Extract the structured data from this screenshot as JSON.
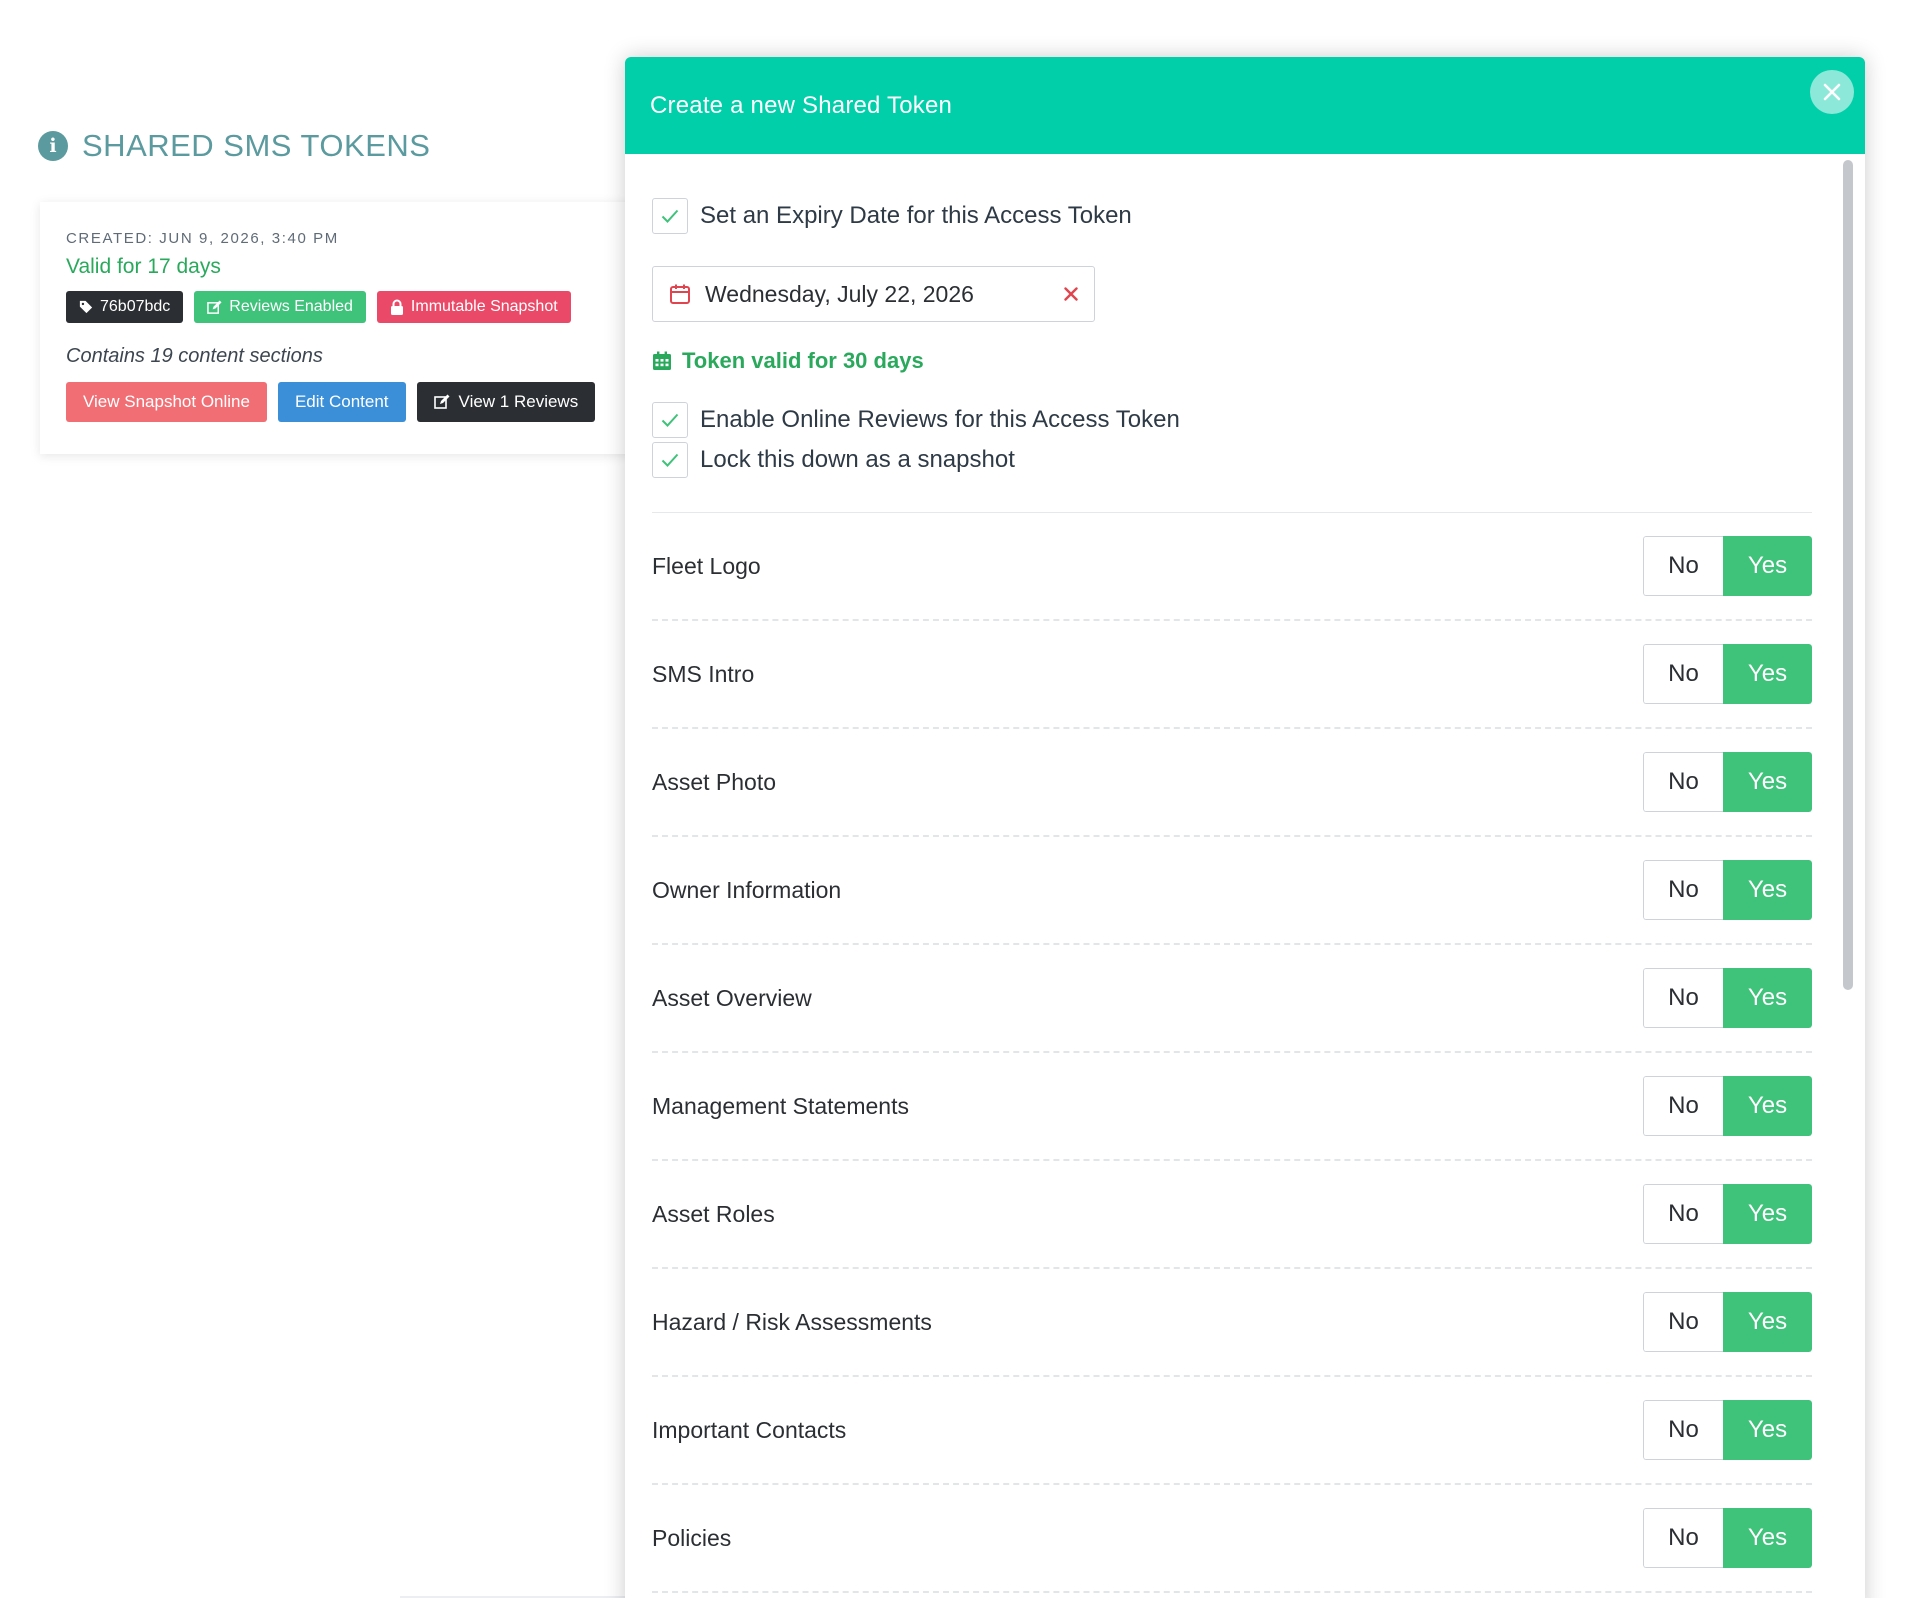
{
  "page": {
    "title": "SHARED SMS TOKENS"
  },
  "token_card": {
    "created": "CREATED: JUN 9, 2026, 3:40 PM",
    "valid": "Valid for 17 days",
    "badges": {
      "id": "76b07bdc",
      "reviews": "Reviews Enabled",
      "snapshot": "Immutable Snapshot"
    },
    "sections_text": "Contains 19 content sections",
    "actions": {
      "view_snapshot": "View Snapshot Online",
      "edit_content": "Edit Content",
      "view_reviews": "View 1 Reviews"
    }
  },
  "modal": {
    "title": "Create a new Shared Token",
    "expiry_checkbox": "Set an Expiry Date for this Access Token",
    "expiry_date": "Wednesday, July 22, 2026",
    "valid_note": "Token valid for 30 days",
    "reviews_checkbox": "Enable Online Reviews for this Access Token",
    "snapshot_checkbox": "Lock this down as a snapshot",
    "toggle_no": "No",
    "toggle_yes": "Yes",
    "sections": [
      {
        "label": "Fleet Logo",
        "value": "Yes"
      },
      {
        "label": "SMS Intro",
        "value": "Yes"
      },
      {
        "label": "Asset Photo",
        "value": "Yes"
      },
      {
        "label": "Owner Information",
        "value": "Yes"
      },
      {
        "label": "Asset Overview",
        "value": "Yes"
      },
      {
        "label": "Management Statements",
        "value": "Yes"
      },
      {
        "label": "Asset Roles",
        "value": "Yes"
      },
      {
        "label": "Hazard / Risk Assessments",
        "value": "Yes"
      },
      {
        "label": "Important Contacts",
        "value": "Yes"
      },
      {
        "label": "Policies",
        "value": "Yes"
      }
    ]
  },
  "colors": {
    "header": "#00cfaa",
    "yes": "#3fc27a",
    "valid_green": "#2aa95d",
    "title_teal": "#5b9a9e"
  }
}
